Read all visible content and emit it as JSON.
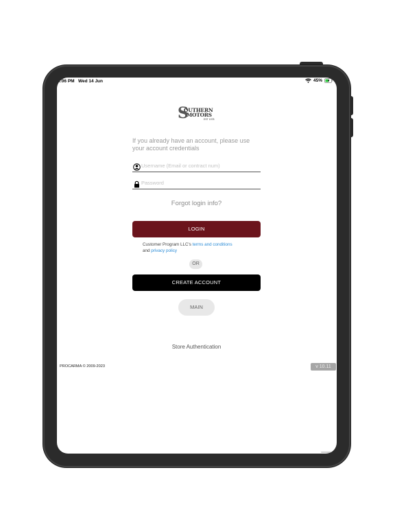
{
  "status_bar": {
    "time": "6:06 PM",
    "date": "Wed 14 Jun",
    "battery": "45%",
    "icons": [
      "wifi-icon",
      "battery-charging-icon"
    ]
  },
  "logo": {
    "line1": "OUTHERN",
    "line2": "MOTORS",
    "big_letter": "S",
    "est": "EST 1978"
  },
  "login": {
    "intro": "If you already have an account, please use your account credentials",
    "username_placeholder": "Username (Email or contract num)",
    "password_placeholder": "Password",
    "forgot": "Forgot login info?",
    "login_button": "LOGIN",
    "terms_prefix": "Customer Program LLC's ",
    "terms_link": "terms and conditions",
    "terms_and": "and ",
    "privacy_link": "privacy policy",
    "or": "OR",
    "create_button": "CREATE ACCOUNT",
    "main_button": "MAIN",
    "store_auth": "Store Authentication"
  },
  "footer": {
    "copyright": "PROCARMA © 2009-2023",
    "version": "v 10.11"
  },
  "colors": {
    "login_button": "#6b141c",
    "create_button": "#000000",
    "link": "#2a8bd6",
    "version_badge": "#a6a6a6"
  }
}
